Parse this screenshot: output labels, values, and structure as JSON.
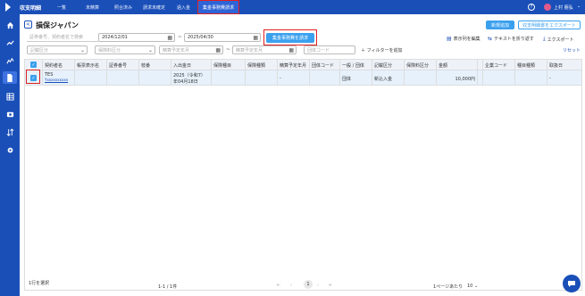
{
  "header": {
    "app_title": "収支明細",
    "nav": [
      "一覧",
      "未精算",
      "照合済み",
      "請求未確定",
      "過入金",
      "集金事務費請求"
    ],
    "active_nav": "集金事務費請求",
    "help_label": "?",
    "user_name": "上村 朋弘"
  },
  "sidebar": {
    "items": [
      "home-icon",
      "trend-icon",
      "chart-icon",
      "document-icon",
      "table-icon",
      "money-icon",
      "transfer-icon",
      "settings-icon"
    ]
  },
  "page": {
    "back_label": "<",
    "title": "損保ジャパン",
    "new_button": "新規追加",
    "export_csv_button": "収支明細書をエクスポート",
    "search_placeholder": "証券番号、契約者名で検索",
    "date_from": "2024/12/01",
    "date_to": "2025/04/30",
    "date_sep": "~",
    "collect_button": "集金事務費を請求",
    "display_columns": "表示列を編集",
    "wrap_text": "テキストを折り返す",
    "export": "エクスポート",
    "filter_type_placeholder": "記載区分",
    "filter_insurance_placeholder": "保険料区分",
    "settle_from_placeholder": "精算予定年月",
    "settle_to_placeholder": "精算予定年月",
    "group_code_placeholder": "団体コード",
    "add_filter": "フィルターを追加",
    "reset": "リセット"
  },
  "table": {
    "headers": [
      "",
      "契約者名",
      "帳票表示名",
      "証券番号",
      "枝番",
      "入出金日",
      "保険種目",
      "保険種類",
      "精算予定年月",
      "団体コード",
      "一般 / 団体",
      "記載区分",
      "保険料区分",
      "金額",
      "",
      "企業コード",
      "種目種類",
      "取扱日"
    ],
    "rows": [
      {
        "contractor": "TES",
        "contractor_sub": "Yxxxxxxxxxx",
        "display_name": "",
        "policy_no": "",
        "branch": "",
        "date_line1": "2025（令和7）",
        "date_line2": "年04月18日",
        "ins_type": "",
        "ins_kind": "",
        "settle": "-",
        "group_code": "",
        "general_group": "団体",
        "entry_type": "新込入金",
        "premium_type": "",
        "amount": "10,000円",
        "extra": "",
        "company_code": "",
        "item_kind": "",
        "handling": "-"
      }
    ]
  },
  "footer": {
    "selected": "1行を選択",
    "range": "1-1 / 1件",
    "page": "1",
    "per_page_label": "1ページあたり",
    "per_page": "10"
  }
}
